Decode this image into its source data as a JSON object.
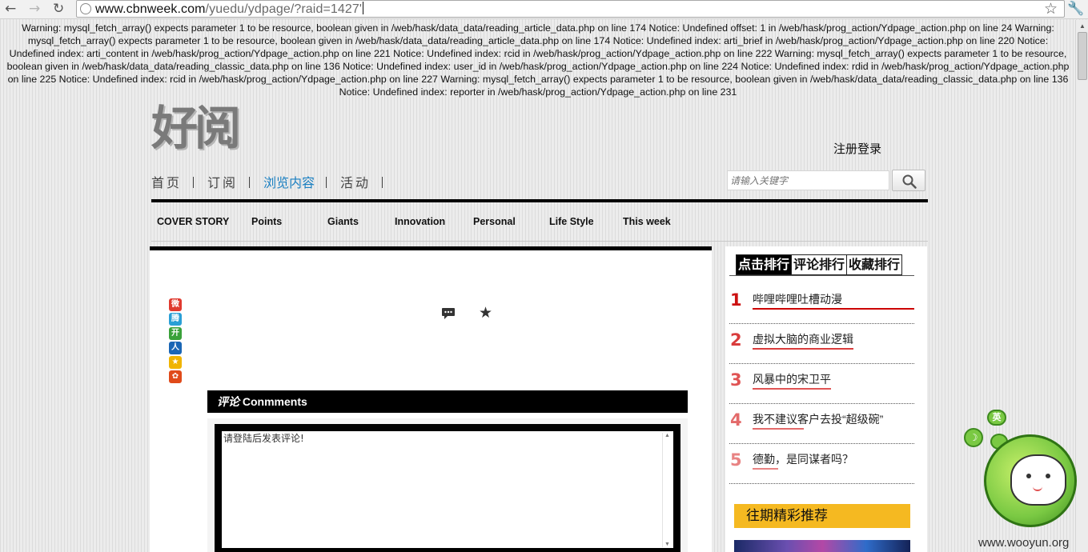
{
  "browser": {
    "url_host": "www.cbnweek.com",
    "url_path": "/yuedu/ydpage/?raid=1427'"
  },
  "warning_text": "Warning: mysql_fetch_array() expects parameter 1 to be resource, boolean given in /web/hask/data_data/reading_article_data.php on line 174 Notice: Undefined offset: 1 in /web/hask/prog_action/Ydpage_action.php on line 24 Warning: mysql_fetch_array() expects parameter 1 to be resource, boolean given in /web/hask/data_data/reading_article_data.php on line 174 Notice: Undefined index: arti_brief in /web/hask/prog_action/Ydpage_action.php on line 220 Notice: Undefined index: arti_content in /web/hask/prog_action/Ydpage_action.php on line 221 Notice: Undefined index: rcid in /web/hask/prog_action/Ydpage_action.php on line 222 Warning: mysql_fetch_array() expects parameter 1 to be resource, boolean given in /web/hask/data_data/reading_classic_data.php on line 136 Notice: Undefined index: user_id in /web/hask/prog_action/Ydpage_action.php on line 224 Notice: Undefined index: rdid in /web/hask/prog_action/Ydpage_action.php on line 225 Notice: Undefined index: rcid in /web/hask/prog_action/Ydpage_action.php on line 227 Warning: mysql_fetch_array() expects parameter 1 to be resource, boolean given in /web/hask/data_data/reading_classic_data.php on line 136 Notice: Undefined index: reporter in /web/hask/prog_action/Ydpage_action.php on line 231",
  "header": {
    "logo": "好阅",
    "register_login": "注册登录",
    "nav": [
      "首页",
      "订阅",
      "浏览内容",
      "活动"
    ],
    "active_nav": "浏览内容",
    "search_placeholder": "请输入关键字"
  },
  "subnav": [
    "COVER STORY",
    "Points",
    "Giants",
    "Innovation",
    "Personal",
    "Life Style",
    "This week"
  ],
  "comments": {
    "header_cn": "评论",
    "header_en": " Conmments",
    "placeholder": "请登陆后发表评论!"
  },
  "sidebar": {
    "tabs": [
      "点击排行",
      "评论排行",
      "收藏排行"
    ],
    "active_tab": "点击排行",
    "ranking": [
      {
        "num": "1",
        "title": "哔哩哔哩吐槽动漫",
        "color": "#cc1111"
      },
      {
        "num": "2",
        "title": "虚拟大脑的商业逻辑",
        "color": "#d93c3c"
      },
      {
        "num": "3",
        "title": "风暴中的宋卫平",
        "color": "#e05454"
      },
      {
        "num": "4",
        "title": "我不建议客户去投“超级碗”",
        "color": "#e36a6a"
      },
      {
        "num": "5",
        "title": "德勤，是同谋者吗？",
        "color": "#e88383"
      }
    ],
    "past_header": "往期精彩推荐"
  },
  "widget": {
    "badge": "英"
  },
  "watermark": "www.wooyun.org",
  "icons": {
    "share": [
      "weibo-icon",
      "tencent-weibo-icon",
      "kaixin-icon",
      "renren-icon",
      "qzone-icon",
      "favorite-share-icon"
    ],
    "share_colors": [
      "#e03a2f",
      "#2a9fd6",
      "#3aa13a",
      "#1a66b5",
      "#f0b400",
      "#e04a1a"
    ]
  }
}
